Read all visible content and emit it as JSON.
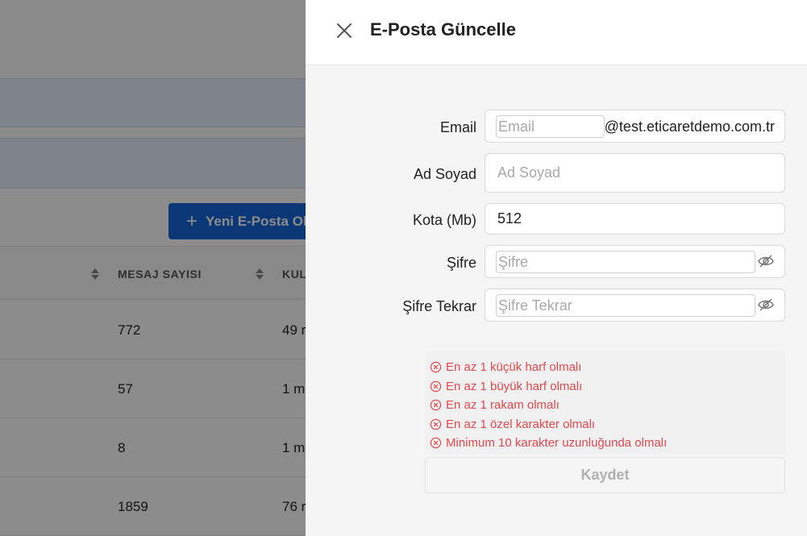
{
  "background": {
    "new_button_label": "Yeni E-Posta Olu",
    "table_headers": [
      "MESAJ SAYISI",
      "KUL"
    ],
    "rows": [
      {
        "messages": "772",
        "usage": "49 r"
      },
      {
        "messages": "57",
        "usage": "1 m"
      },
      {
        "messages": "8",
        "usage": "1 m"
      },
      {
        "messages": "1859",
        "usage": "76 r"
      }
    ]
  },
  "drawer": {
    "title": "E-Posta Güncelle",
    "form": {
      "email_label": "Email",
      "email_placeholder": "Email",
      "email_domain": "@test.eticaretdemo.com.tr",
      "name_label": "Ad Soyad",
      "name_placeholder": "Ad Soyad",
      "quota_label": "Kota (Mb)",
      "quota_value": "512",
      "password_label": "Şifre",
      "password_placeholder": "Şifre",
      "password_confirm_label": "Şifre Tekrar",
      "password_confirm_placeholder": "Şifre Tekrar"
    },
    "validation_errors": [
      "En az 1 küçük harf olmalı",
      "En az 1 büyük harf olmalı",
      "En az 1 rakam olmalı",
      "En az 1 özel karakter olmalı",
      "Minimum 10 karakter uzunluğunda olmalı"
    ],
    "save_label": "Kaydet"
  },
  "colors": {
    "primary": "#1565d8",
    "error": "#e5484d",
    "overlay": "rgba(0,0,0,0.45)"
  }
}
